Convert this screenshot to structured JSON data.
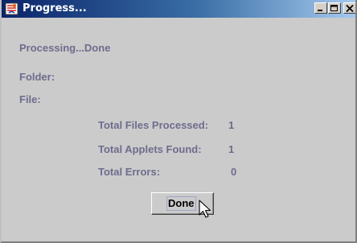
{
  "window": {
    "title": "Progress...",
    "icon": "java-app-icon",
    "controls": [
      "minimize-icon",
      "maximize-icon",
      "close-icon"
    ]
  },
  "status": {
    "text": "Processing...Done"
  },
  "fields": {
    "folder_label": "Folder:",
    "file_label": "File:"
  },
  "stats": [
    {
      "label": "Total Files Processed:",
      "value": "1"
    },
    {
      "label": "Total Applets Found:",
      "value": "1"
    },
    {
      "label": "Total Errors:",
      "value": "0"
    }
  ],
  "actions": {
    "done_label": "Done"
  },
  "colors": {
    "label_text": "#6e6c8e",
    "titlebar_start": "#0a246a",
    "titlebar_end": "#a6caf0",
    "window_bg": "#cbcbcb"
  }
}
